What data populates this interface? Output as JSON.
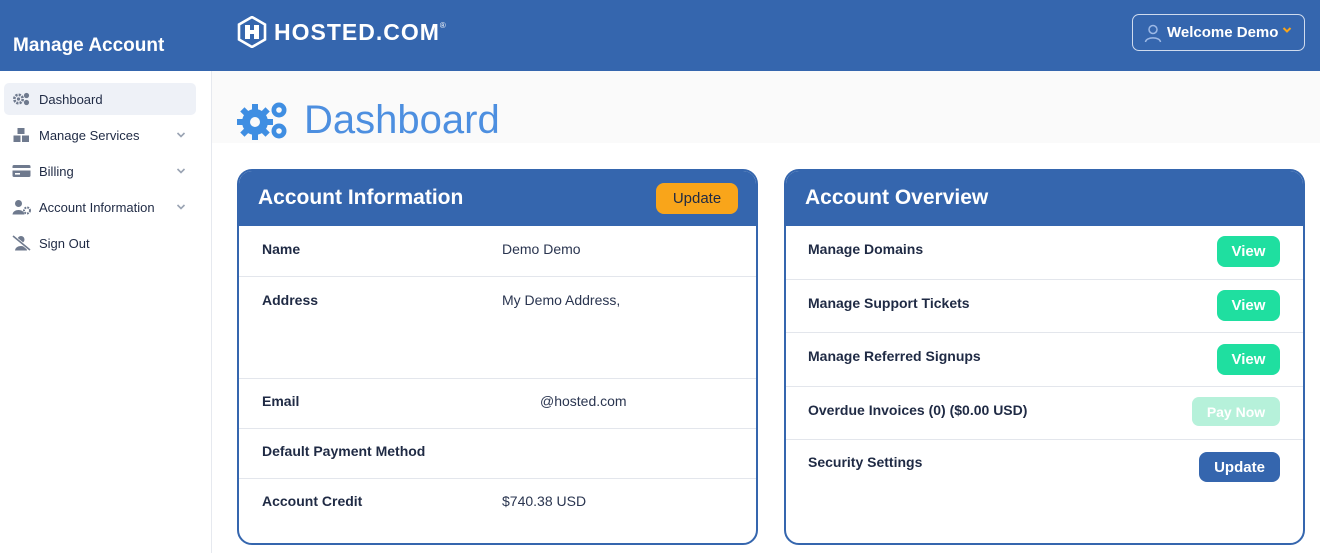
{
  "header": {
    "sidebar_title": "Manage Account",
    "logo_text": "HOSTED.COM",
    "logo_mark": "®",
    "welcome": "Welcome Demo"
  },
  "sidebar": {
    "items": [
      {
        "label": "Dashboard",
        "icon": "cogs-icon",
        "active": true,
        "expandable": false
      },
      {
        "label": "Manage Services",
        "icon": "boxes-icon",
        "active": false,
        "expandable": true
      },
      {
        "label": "Billing",
        "icon": "credit-card-icon",
        "active": false,
        "expandable": true
      },
      {
        "label": "Account Information",
        "icon": "user-cog-icon",
        "active": false,
        "expandable": true
      },
      {
        "label": "Sign Out",
        "icon": "user-slash-icon",
        "active": false,
        "expandable": false
      }
    ]
  },
  "page": {
    "title": "Dashboard"
  },
  "account_info": {
    "title": "Account Information",
    "update_label": "Update",
    "rows": [
      {
        "label": "Name",
        "value": "Demo Demo"
      },
      {
        "label": "Address",
        "value": "My Demo Address,"
      },
      {
        "label": "Email",
        "value": "@hosted.com"
      },
      {
        "label": "Default Payment Method",
        "value": ""
      },
      {
        "label": "Account Credit",
        "value": "$740.38 USD"
      }
    ]
  },
  "account_overview": {
    "title": "Account Overview",
    "rows": [
      {
        "label": "Manage Domains",
        "action": "View"
      },
      {
        "label": "Manage Support Tickets",
        "action": "View"
      },
      {
        "label": "Manage Referred Signups",
        "action": "View"
      },
      {
        "label": "Overdue Invoices (0) ($0.00 USD)",
        "action": "Pay Now"
      },
      {
        "label": "Security Settings",
        "action": "Update"
      }
    ]
  },
  "colors": {
    "brand_blue": "#3566ae",
    "title_blue": "#4d8fe0",
    "orange": "#f9a51a",
    "green": "#1fdfa0",
    "green_disabled": "#b6f1da"
  }
}
